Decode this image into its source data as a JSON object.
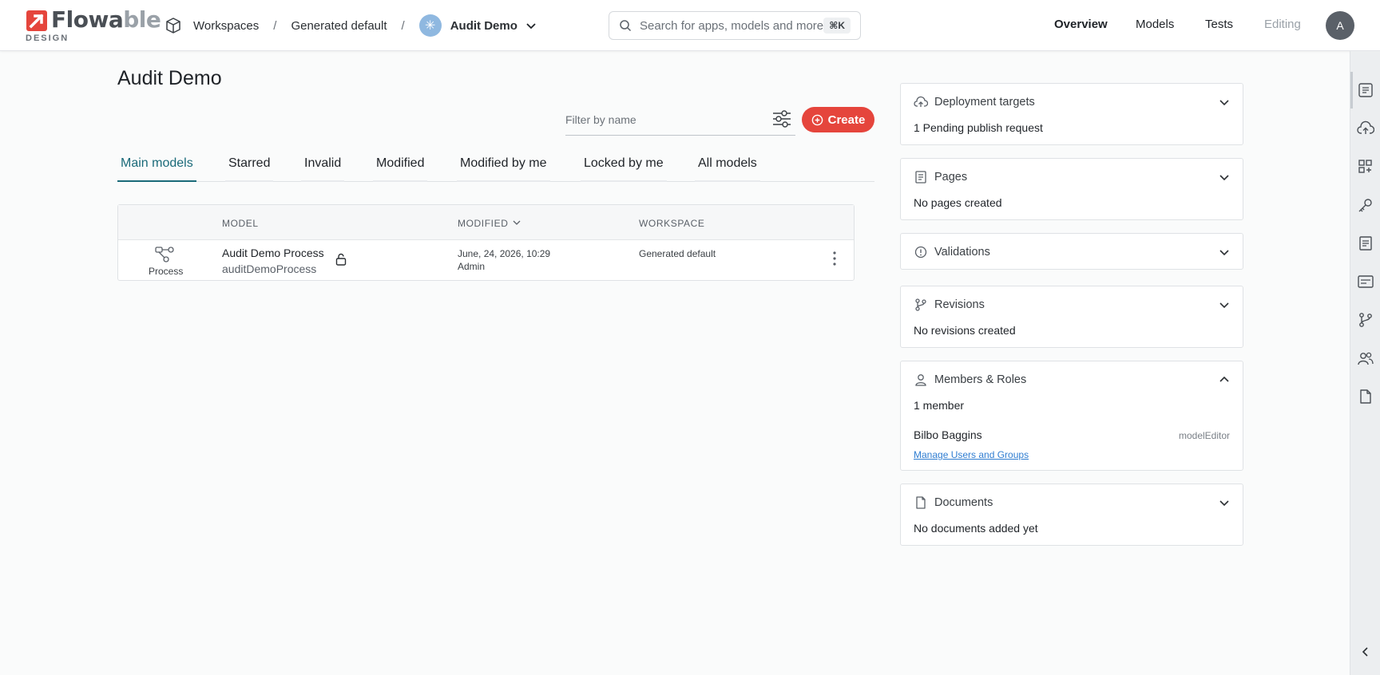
{
  "brand": {
    "name_a": "Flowa",
    "name_b": "ble",
    "sub": "DESIGN",
    "color": "#e5453c"
  },
  "breadcrumb": {
    "workspaces": "Workspaces",
    "workspace": "Generated default",
    "app": "Audit Demo",
    "app_badge": "✳"
  },
  "search": {
    "placeholder": "Search for apps, models and more",
    "shortcut": "⌘K"
  },
  "nav": {
    "overview": "Overview",
    "models": "Models",
    "tests": "Tests",
    "editing": "Editing"
  },
  "user": {
    "initial": "A"
  },
  "page": {
    "title": "Audit Demo",
    "filter_placeholder": "Filter by name",
    "create_label": "Create"
  },
  "tabs": [
    "Main models",
    "Starred",
    "Invalid",
    "Modified",
    "Modified by me",
    "Locked by me",
    "All models"
  ],
  "table": {
    "headers": {
      "model": "MODEL",
      "modified": "MODIFIED",
      "workspace": "WORKSPACE"
    },
    "rows": [
      {
        "type": "Process",
        "name": "Audit Demo Process",
        "key": "auditDemoProcess",
        "modified": "June, 24, 2026, 10:29",
        "modified_by": "Admin",
        "workspace": "Generated default"
      }
    ]
  },
  "panels": {
    "deployment": {
      "title": "Deployment targets",
      "body": "1 Pending publish request"
    },
    "pages": {
      "title": "Pages",
      "body": "No pages created"
    },
    "validations": {
      "title": "Validations"
    },
    "revisions": {
      "title": "Revisions",
      "body": "No revisions created"
    },
    "members": {
      "title": "Members & Roles",
      "count": "1 member",
      "member_name": "Bilbo Baggins",
      "member_role": "modelEditor",
      "manage_link": "Manage Users and Groups"
    },
    "documents": {
      "title": "Documents",
      "body": "No documents added yet"
    }
  },
  "colors": {
    "accent": "#1a6a79",
    "primary_button": "#e5453c",
    "link": "#2f7dd1"
  },
  "rail_icons": [
    "overview-icon",
    "cloud-upload-icon",
    "apps-icon",
    "key-icon",
    "pages-icon",
    "forms-icon",
    "branch-icon",
    "users-icon",
    "document-icon"
  ]
}
